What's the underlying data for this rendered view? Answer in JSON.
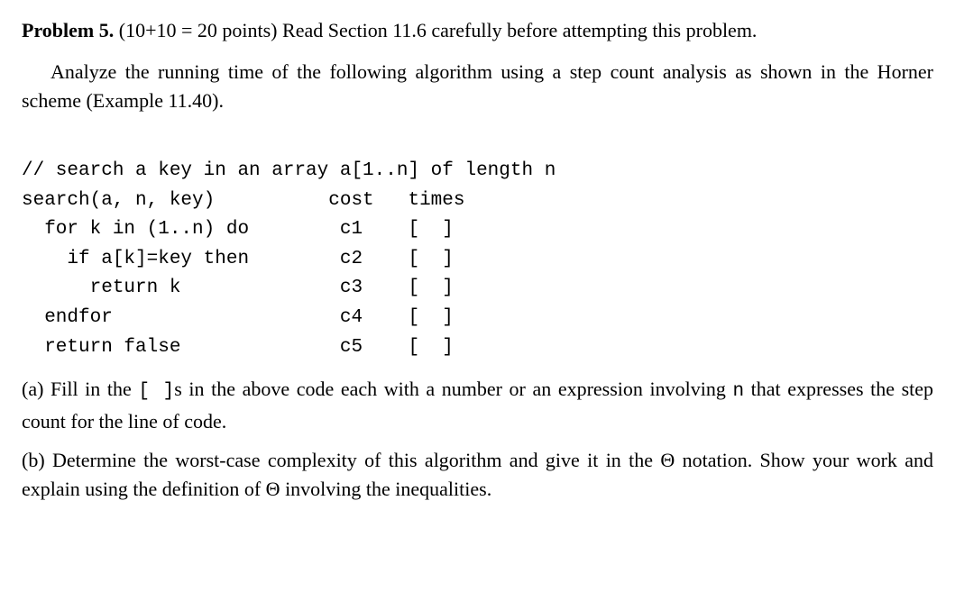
{
  "heading": {
    "title": "Problem 5.",
    "points": " (10+10 = 20 points) ",
    "instruction": "Read Section 11.6 carefully before attempting this problem."
  },
  "intro": "Analyze the running time of the following algorithm using a step count analysis as shown in the Horner scheme (Example 11.40).",
  "code": {
    "l1": "// search a key in an array a[1..n] of length n",
    "l2": "search(a, n, key)          cost   times",
    "l3": "  for k in (1..n) do        c1    [  ]",
    "l4": "    if a[k]=key then        c2    [  ]",
    "l5": "      return k              c3    [  ]",
    "l6": "  endfor                    c4    [  ]",
    "l7": "  return false              c5    [  ]"
  },
  "part_a": {
    "label": "(a) ",
    "text1": "Fill in the ",
    "bracket": "[  ]",
    "text2": "s in the above code each with a number or an expression involving ",
    "var": "n",
    "text3": " that expresses the step count for the line of code."
  },
  "part_b": {
    "label": "(b) ",
    "text1": "Determine the worst-case complexity of this algorithm and give it in the ",
    "theta1": "Θ",
    "text2": " notation. Show your work and explain using the definition of ",
    "theta2": "Θ",
    "text3": " involving the inequalities."
  }
}
